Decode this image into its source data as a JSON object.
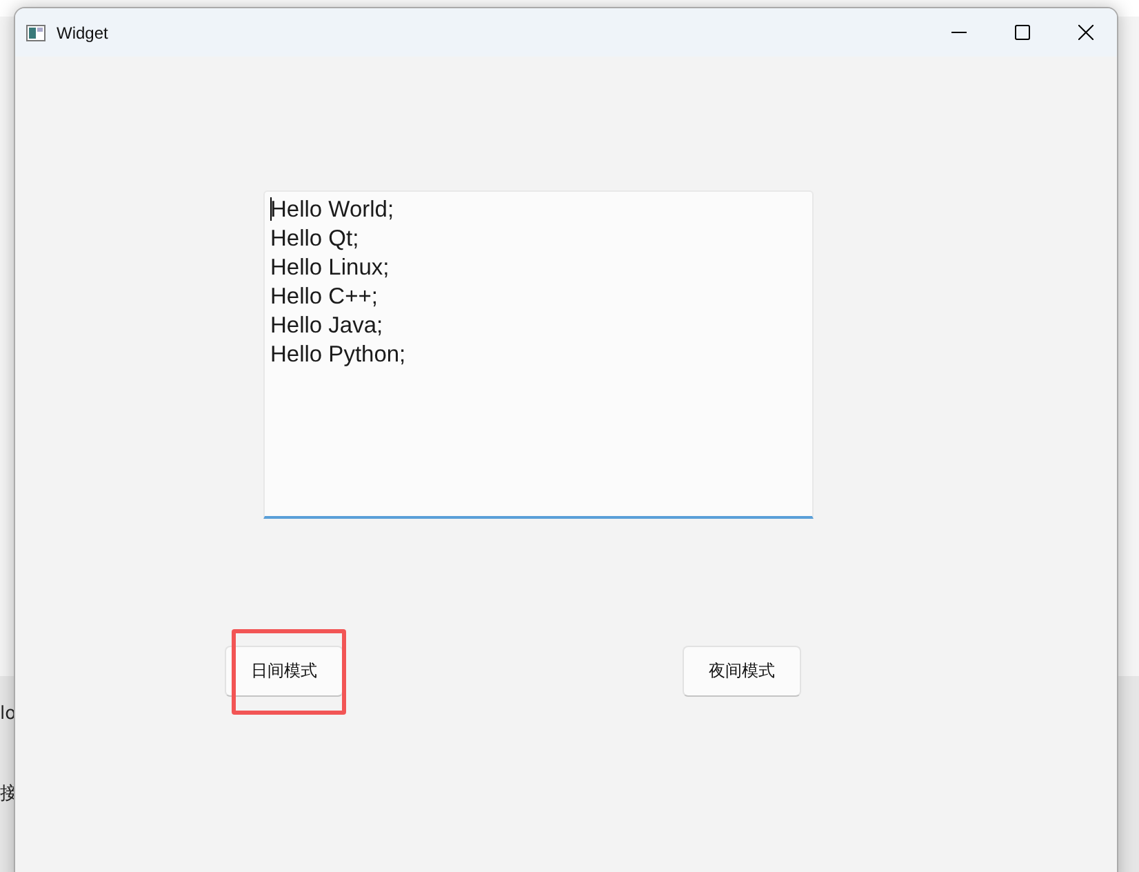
{
  "background_window": {
    "texts": [
      "lo",
      "接"
    ]
  },
  "window": {
    "title": "Widget"
  },
  "editor": {
    "lines": [
      "Hello World;",
      "Hello Qt;",
      "Hello Linux;",
      "Hello C++;",
      "Hello Java;",
      "Hello Python;"
    ],
    "focused": true
  },
  "buttons": [
    {
      "label": "日间模式",
      "highlighted": true
    },
    {
      "label": "夜间模式",
      "highlighted": false
    }
  ]
}
